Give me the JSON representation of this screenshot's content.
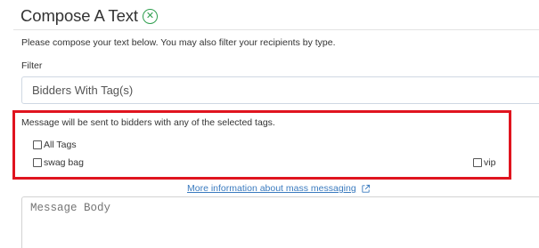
{
  "header": {
    "title": "Compose A Text",
    "close_icon": "circle-x-icon",
    "accent_color": "#2e9e4e"
  },
  "instructions": "Please compose your text below. You may also filter your recipients by type.",
  "filter": {
    "label": "Filter",
    "selected": "Bidders With Tag(s)"
  },
  "tags_panel": {
    "message": "Message will be sent to bidders with any of the selected tags.",
    "highlight_color": "#e0141f",
    "options": [
      {
        "label": "All Tags",
        "checked": false
      },
      {
        "label": "swag bag",
        "checked": false
      },
      {
        "label": "vip",
        "checked": false
      }
    ]
  },
  "more_info": {
    "text": "More information about mass messaging",
    "icon": "external-link-icon",
    "color": "#3b7bbf"
  },
  "message_body": {
    "placeholder": "Message Body"
  }
}
